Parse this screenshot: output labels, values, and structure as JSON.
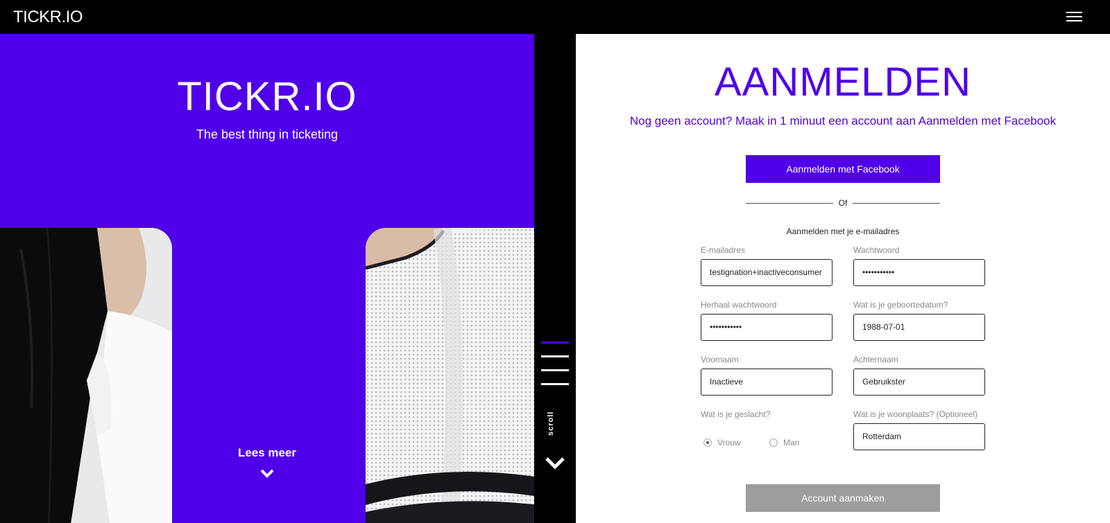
{
  "header": {
    "brand": "TICKR.IO"
  },
  "hero": {
    "title": "TICKR.IO",
    "subtitle": "The best thing in ticketing",
    "read_more": "Lees meer"
  },
  "rail": {
    "scroll_label": "scroll"
  },
  "form": {
    "title": "AANMELDEN",
    "subtitle": "Nog geen account? Maak in 1 minuut een account aan Aanmelden met Facebook",
    "facebook_button": "Aanmelden met Facebook",
    "or_text": "Of",
    "email_heading": "Aanmelden met je e-mailadres",
    "fields": {
      "email": {
        "label": "E-mailadres",
        "value": "testignation+inactiveconsumer"
      },
      "password": {
        "label": "Wachtwoord",
        "value": "•••••••••••"
      },
      "repeat_password": {
        "label": "Herhaal wachtwoord",
        "value": "•••••••••••"
      },
      "birthdate": {
        "label": "Wat is je geboortedatum?",
        "value": "1988-07-01"
      },
      "first_name": {
        "label": "Voornaam",
        "value": "Inactieve"
      },
      "last_name": {
        "label": "Achternaam",
        "value": "Gebruikster"
      },
      "gender": {
        "label": "Wat is je geslacht?",
        "option_female": "Vrouw",
        "option_male": "Man",
        "selected": "Vrouw"
      },
      "city": {
        "label": "Wat is je woonplaats? (Optioneel)",
        "value": "Rotterdam"
      }
    },
    "create_button": "Account aanmaken"
  },
  "colors": {
    "accent": "#5000e8",
    "disabled_button": "#9e9e9e"
  }
}
